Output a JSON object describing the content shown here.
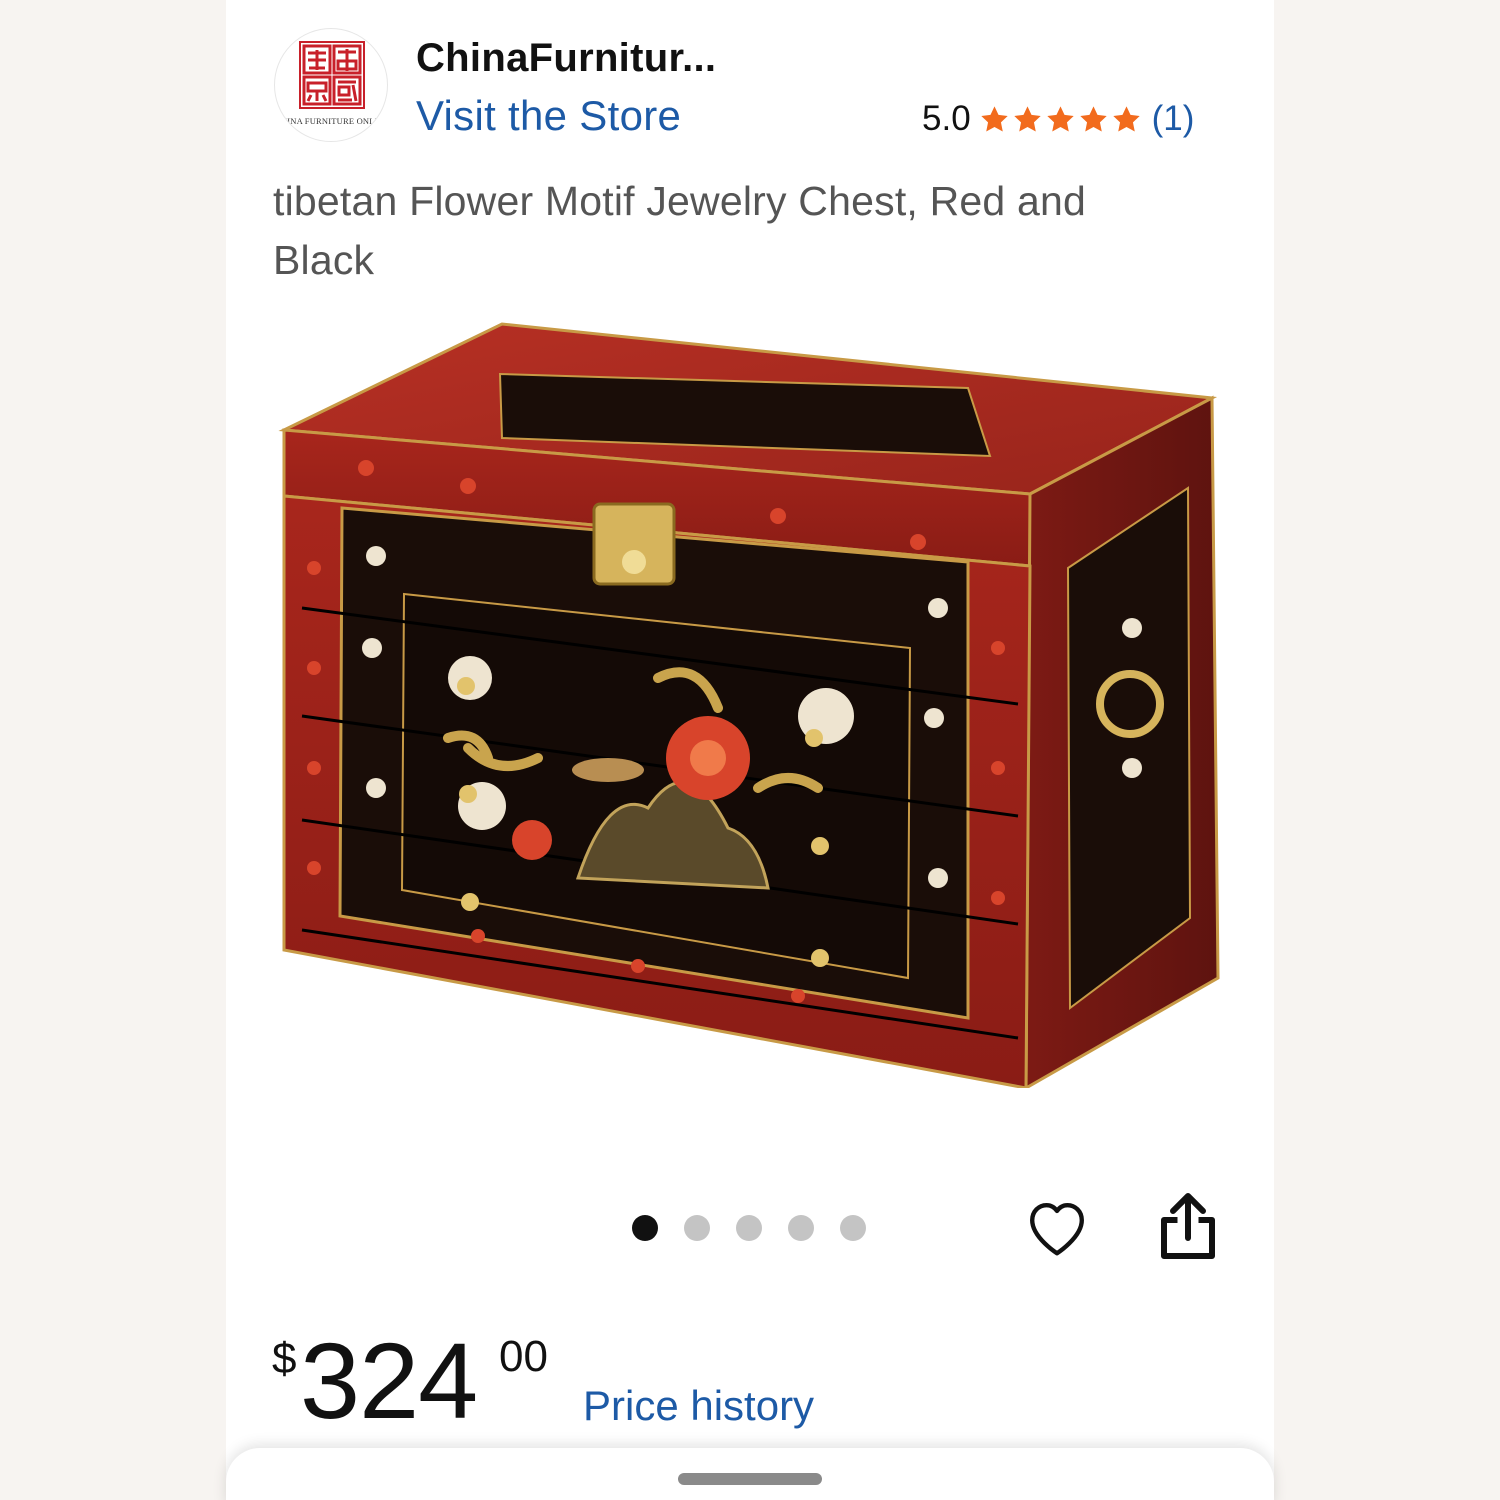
{
  "store": {
    "logo_icon": "china-furniture-seal-logo",
    "logo_text": "CHINA FURNITURE ONLINE",
    "name": "ChinaFurnitur...",
    "visit_label": "Visit the Store"
  },
  "rating": {
    "score": "5.0",
    "stars": 5,
    "count": "(1)",
    "star_color": "#f26b1d"
  },
  "product": {
    "title": "tibetan Flower Motif Jewelry Chest, Red and Black",
    "image_icon": "red-black-lacquered-jewelry-chest-image"
  },
  "carousel": {
    "total": 5,
    "active_index": 0
  },
  "actions": {
    "favorite_icon": "heart-icon",
    "share_icon": "share-icon"
  },
  "price": {
    "currency": "$",
    "whole": "324",
    "cents": "00",
    "history_label": "Price history"
  },
  "colors": {
    "link": "#1d5aa6",
    "text": "#111111",
    "title_text": "#555555",
    "page_bg": "#f7f4f1"
  }
}
